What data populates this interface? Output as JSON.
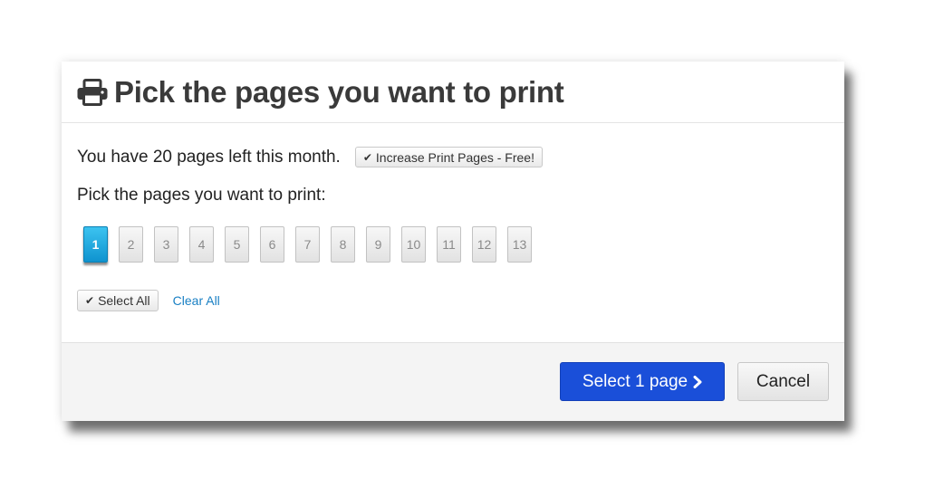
{
  "dialog": {
    "title": "Pick the pages you want to print",
    "title_icon": "printer-icon"
  },
  "body": {
    "pages_left_text": "You have 20 pages left this month.",
    "increase_button_label": "Increase Print Pages - Free!",
    "instruction": "Pick the pages you want to print:",
    "pages": [
      {
        "label": "1",
        "selected": true
      },
      {
        "label": "2",
        "selected": false
      },
      {
        "label": "3",
        "selected": false
      },
      {
        "label": "4",
        "selected": false
      },
      {
        "label": "5",
        "selected": false
      },
      {
        "label": "6",
        "selected": false
      },
      {
        "label": "7",
        "selected": false
      },
      {
        "label": "8",
        "selected": false
      },
      {
        "label": "9",
        "selected": false
      },
      {
        "label": "10",
        "selected": false
      },
      {
        "label": "11",
        "selected": false
      },
      {
        "label": "12",
        "selected": false
      },
      {
        "label": "13",
        "selected": false
      }
    ],
    "select_all_label": "Select All",
    "clear_all_label": "Clear All"
  },
  "footer": {
    "primary_label": "Select 1 page",
    "cancel_label": "Cancel"
  },
  "colors": {
    "primary": "#1a4fd9",
    "selected_page": "#1aa6e0",
    "link": "#1a80c4"
  }
}
